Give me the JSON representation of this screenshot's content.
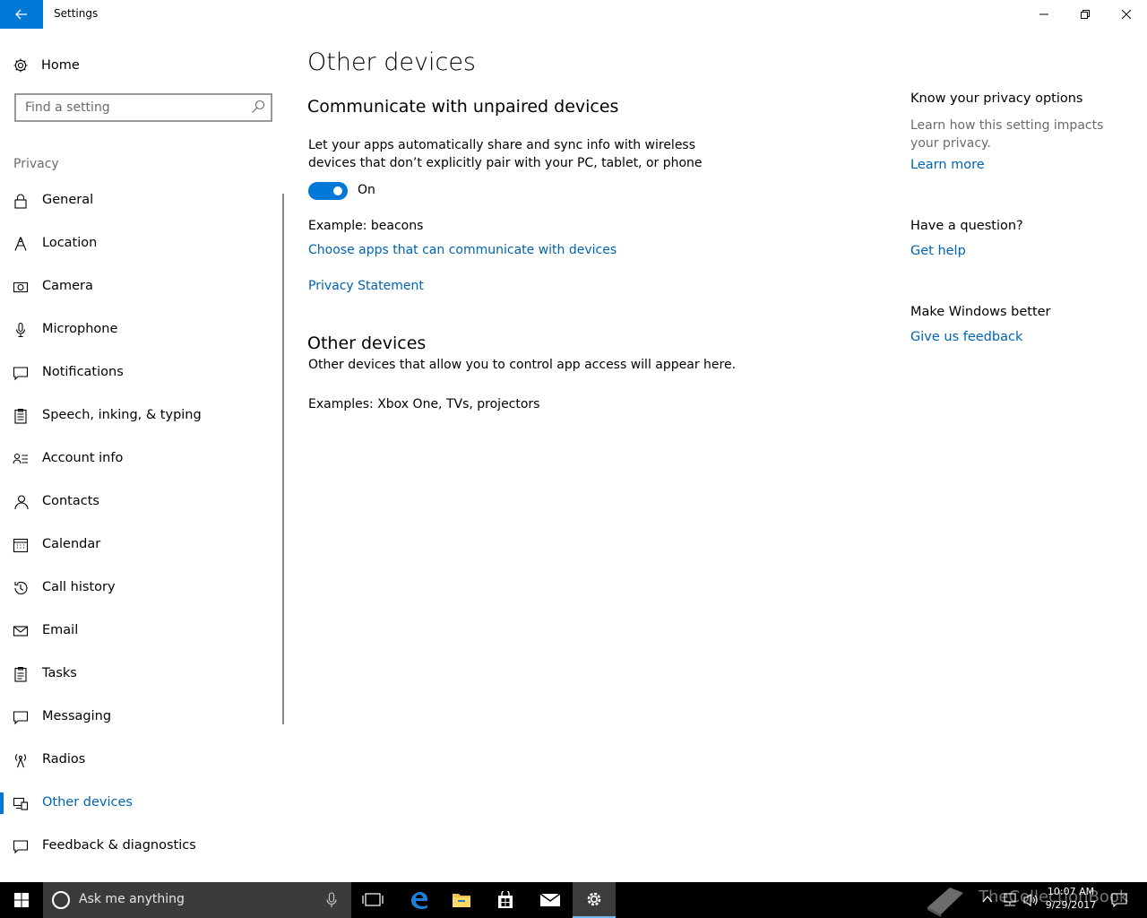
{
  "window": {
    "title": "Settings"
  },
  "sidebar": {
    "home_label": "Home",
    "search_placeholder": "Find a setting",
    "section_label": "Privacy",
    "items": [
      {
        "label": "General",
        "icon": "lock-icon"
      },
      {
        "label": "Location",
        "icon": "location-icon"
      },
      {
        "label": "Camera",
        "icon": "camera-icon"
      },
      {
        "label": "Microphone",
        "icon": "microphone-icon"
      },
      {
        "label": "Notifications",
        "icon": "notifications-icon"
      },
      {
        "label": "Speech, inking, & typing",
        "icon": "clipboard-icon"
      },
      {
        "label": "Account info",
        "icon": "account-info-icon"
      },
      {
        "label": "Contacts",
        "icon": "contacts-icon"
      },
      {
        "label": "Calendar",
        "icon": "calendar-icon"
      },
      {
        "label": "Call history",
        "icon": "history-icon"
      },
      {
        "label": "Email",
        "icon": "email-icon"
      },
      {
        "label": "Tasks",
        "icon": "tasks-icon"
      },
      {
        "label": "Messaging",
        "icon": "messaging-icon"
      },
      {
        "label": "Radios",
        "icon": "radio-tower-icon"
      },
      {
        "label": "Other devices",
        "icon": "devices-icon",
        "active": true
      },
      {
        "label": "Feedback & diagnostics",
        "icon": "feedback-icon"
      }
    ]
  },
  "main": {
    "page_title": "Other devices",
    "section1": {
      "heading": "Communicate with unpaired devices",
      "description_line1": "Let your apps automatically share and sync info with wireless",
      "description_line2": "devices that don’t explicitly pair with your PC, tablet, or phone",
      "toggle_state": "On",
      "example": "Example: beacons",
      "link_choose_apps": "Choose apps that can communicate with devices",
      "link_privacy": "Privacy Statement"
    },
    "section2": {
      "heading": "Other devices",
      "description": "Other devices that allow you to control app access will appear here.",
      "examples": "Examples: Xbox One, TVs, projectors"
    }
  },
  "aside": {
    "privacy_heading": "Know your privacy options",
    "privacy_text": "Learn how this setting impacts your privacy.",
    "learn_more": "Learn more",
    "question_heading": "Have a question?",
    "get_help": "Get help",
    "better_heading": "Make Windows better",
    "feedback_link": "Give us feedback"
  },
  "taskbar": {
    "search_placeholder": "Ask me anything",
    "time": "10:07 AM",
    "date": "9/29/2017",
    "watermark": "TheCollectionBook"
  },
  "colors": {
    "accent": "#0078d7",
    "link": "#0063b1",
    "taskbar": "#000000"
  }
}
